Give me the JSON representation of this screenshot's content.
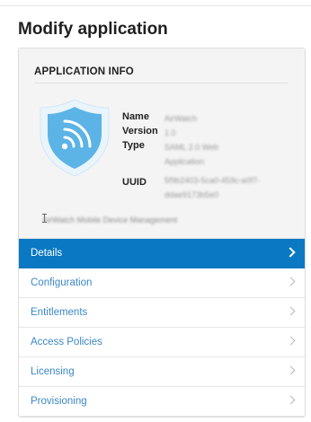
{
  "page": {
    "title": "Modify application"
  },
  "app_info": {
    "heading": "APPLICATION INFO",
    "icon": "wifi-shield-icon",
    "icon_colors": {
      "shield_outer": "#e9f4fb",
      "shield_inner": "#5bb3e6",
      "waves": "#ffffff"
    },
    "fields": [
      {
        "label": "Name",
        "value": "AirWatch"
      },
      {
        "label": "Version",
        "value": "1.0"
      },
      {
        "label": "Type",
        "value": "SAML 2.0 Web Application"
      },
      {
        "label": "UUID",
        "value": "5f9b2403-5ca0-459c-a0f7-ddae9173b5e0"
      }
    ],
    "description": "AirWatch Mobile Device Management"
  },
  "nav": {
    "items": [
      {
        "label": "Details",
        "active": true
      },
      {
        "label": "Configuration",
        "active": false
      },
      {
        "label": "Entitlements",
        "active": false
      },
      {
        "label": "Access Policies",
        "active": false
      },
      {
        "label": "Licensing",
        "active": false
      },
      {
        "label": "Provisioning",
        "active": false
      }
    ]
  },
  "colors": {
    "accent": "#0a78c2",
    "link": "#3c87c4"
  }
}
